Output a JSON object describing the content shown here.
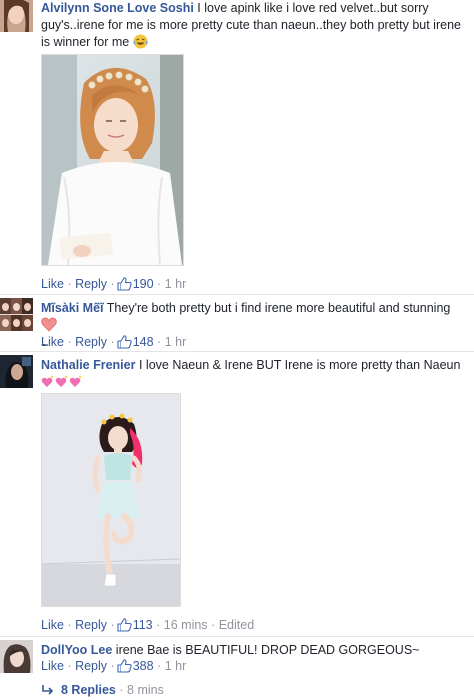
{
  "comments": [
    {
      "author": "Alvilynn Sone Love Soshi",
      "text": "I love apink like i love red velvet..but sorry guy's..irene for me is more pretty cute than naeun..they both pretty but irene is winner for me",
      "emoji": "laughing-face-emoji",
      "like_label": "Like",
      "reply_label": "Reply",
      "likes": "190",
      "time": "1 hr"
    },
    {
      "author": "Mĩsàki Mẽĩ",
      "text": "They're both pretty but i find irene more beautiful and stunning",
      "emoji": "heart-emoji",
      "text_tail": "~",
      "like_label": "Like",
      "reply_label": "Reply",
      "likes": "148",
      "time": "1 hr"
    },
    {
      "author": "Nathalie Frenier",
      "text": "I love Naeun & Irene BUT Irene is more pretty than Naeun",
      "emoji": "sparkling-heart-emoji",
      "like_label": "Like",
      "reply_label": "Reply",
      "likes": "113",
      "time": "16 mins",
      "edited": "Edited"
    },
    {
      "author": "DollYoo Lee",
      "text": "irene Bae is BEAUTIFUL! DROP DEAD GORGEOUS~",
      "like_label": "Like",
      "reply_label": "Reply",
      "likes": "388",
      "time": "1 hr"
    }
  ],
  "replies": {
    "label": "8 Replies",
    "time": "8 mins"
  },
  "colors": {
    "link": "#365899",
    "meta": "#90949c",
    "text": "#1d2129",
    "divider": "#e5e5e5"
  },
  "icons": [
    "thumbs-up-icon",
    "reply-arrow-icon"
  ]
}
